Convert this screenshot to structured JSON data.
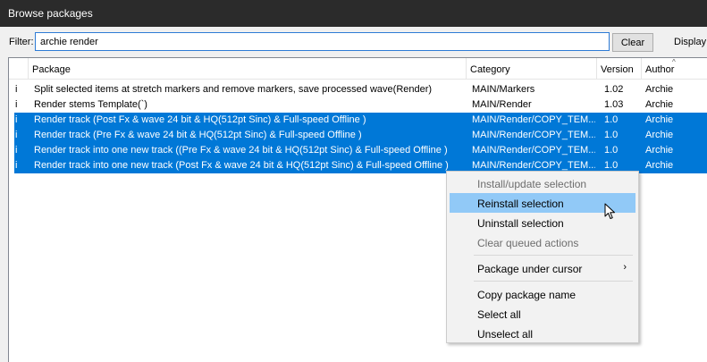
{
  "window": {
    "title": "Browse packages"
  },
  "filter": {
    "label": "Filter:",
    "value": "archie render",
    "clear_label": "Clear",
    "display_label": "Display:"
  },
  "columns": {
    "package": "Package",
    "category": "Category",
    "version": "Version",
    "author": "Author"
  },
  "rows": [
    {
      "flag": "i",
      "package": "Split selected items at stretch markers and remove markers, save processed wave(Render)",
      "category": "MAIN/Markers",
      "version": "1.02",
      "author": "Archie",
      "selected": false
    },
    {
      "flag": "i",
      "package": "Render stems Template(`)",
      "category": "MAIN/Render",
      "version": "1.03",
      "author": "Archie",
      "selected": false
    },
    {
      "flag": "i",
      "package": "Render track (Post Fx & wave 24 bit & HQ(512pt Sinc) & Full-speed Offline )",
      "category": "MAIN/Render/COPY_TEM...",
      "version": "1.0",
      "author": "Archie",
      "selected": true
    },
    {
      "flag": "i",
      "package": "Render track (Pre Fx & wave 24 bit & HQ(512pt Sinc) & Full-speed Offline )",
      "category": "MAIN/Render/COPY_TEM...",
      "version": "1.0",
      "author": "Archie",
      "selected": true
    },
    {
      "flag": "i",
      "package": "Render track into one new track ((Pre Fx & wave 24 bit & HQ(512pt Sinc) & Full-speed Offline )",
      "category": "MAIN/Render/COPY_TEM...",
      "version": "1.0",
      "author": "Archie",
      "selected": true
    },
    {
      "flag": "i",
      "package": "Render track into one new track (Post Fx & wave 24 bit & HQ(512pt Sinc) & Full-speed Offline )",
      "category": "MAIN/Render/COPY_TEM...",
      "version": "1.0",
      "author": "Archie",
      "selected": true
    }
  ],
  "context_menu": {
    "items": [
      {
        "label": "Install/update selection",
        "disabled": true
      },
      {
        "label": "Reinstall selection",
        "highlighted": true
      },
      {
        "label": "Uninstall selection"
      },
      {
        "label": "Clear queued actions",
        "disabled": true
      },
      {
        "label": "Package under cursor",
        "submenu_arrow": "›"
      },
      {
        "label": "Copy package name"
      },
      {
        "label": "Select all"
      },
      {
        "label": "Unselect all"
      }
    ]
  },
  "icons": {
    "sort": "sort-ascending-icon",
    "cursor": "mouse-pointer-icon"
  },
  "colors": {
    "selection": "#0078d7",
    "menu_highlight": "#91c9f7",
    "titlebar": "#2b2b2b"
  }
}
